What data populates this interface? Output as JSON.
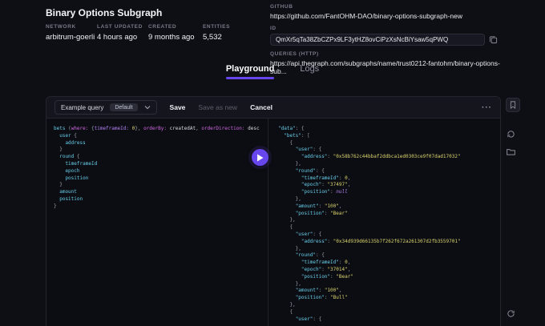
{
  "header": {
    "title": "Binary Options Subgraph",
    "meta": [
      {
        "label": "NETWORK",
        "value": "arbitrum-goerli"
      },
      {
        "label": "LAST UPDATED",
        "value": "4 hours ago"
      },
      {
        "label": "CREATED",
        "value": "9 months ago"
      },
      {
        "label": "ENTITIES",
        "value": "5,532"
      }
    ],
    "github_label": "GITHUB",
    "github_url": "https://github.com/FantOHM-DAO/binary-options-subgraph-new",
    "id_label": "ID",
    "id_value": "QmXr5qTa38ZbCZPx9LF3ytHZ8ovCiPzXsNcBiYsaw5qPWQ",
    "queries_label": "QUERIES (HTTP)",
    "queries_url": "https://api.thegraph.com/subgraphs/name/trust0212-fantohm/binary-options-sub..."
  },
  "tabs": [
    {
      "label": "Playground",
      "active": true
    },
    {
      "label": "Logs",
      "active": false
    }
  ],
  "toolbar": {
    "query_selector_label": "Example query",
    "query_selector_badge": "Default",
    "save_label": "Save",
    "save_as_new_label": "Save as new",
    "cancel_label": "Cancel",
    "more_label": "···"
  },
  "colors": {
    "accent": "#6747ed",
    "syn-field": "#67cdea",
    "syn-kw": "#cf68e1",
    "syn-attr": "#b381f5",
    "syn-num": "#d9d26e",
    "syn-key": "#67cdea",
    "syn-str": "#d9d26e",
    "syn-nul": "#b381f5",
    "syn-pun": "#9aa0ae",
    "syn-val": "#d6dae4"
  },
  "playground": {
    "query_lines": [
      [
        [
          "bets ",
          "field"
        ],
        [
          "(",
          "pun"
        ],
        [
          "where: ",
          "kw"
        ],
        [
          "{",
          "pun"
        ],
        [
          "timeframeId: ",
          "attr"
        ],
        [
          "0",
          "num"
        ],
        [
          "}",
          "pun"
        ],
        [
          ", ",
          "pun"
        ],
        [
          "orderBy: ",
          "kw"
        ],
        [
          "createdAt",
          "val"
        ],
        [
          ", ",
          "pun"
        ],
        [
          "orderDirection: ",
          "kw"
        ],
        [
          "desc",
          "val"
        ]
      ],
      [
        [
          "  user ",
          "field"
        ],
        [
          "{",
          "pun"
        ]
      ],
      [
        [
          "    address",
          "field"
        ]
      ],
      [
        [
          "  }",
          "pun"
        ]
      ],
      [
        [
          "  round ",
          "field"
        ],
        [
          "{",
          "pun"
        ]
      ],
      [
        [
          "    timeframeId",
          "field"
        ]
      ],
      [
        [
          "    epoch",
          "field"
        ]
      ],
      [
        [
          "    position",
          "field"
        ]
      ],
      [
        [
          "  }",
          "pun"
        ]
      ],
      [
        [
          "  amount",
          "field"
        ]
      ],
      [
        [
          "  position",
          "field"
        ]
      ],
      [
        [
          "}",
          "pun"
        ]
      ]
    ],
    "result_lines": [
      [
        [
          "\"data\"",
          "key"
        ],
        [
          ": {",
          "pun"
        ]
      ],
      [
        [
          "  ",
          "pun"
        ],
        [
          "\"bets\"",
          "key"
        ],
        [
          ": [",
          "pun"
        ]
      ],
      [
        [
          "    {",
          "pun"
        ]
      ],
      [
        [
          "      ",
          "pun"
        ],
        [
          "\"user\"",
          "key"
        ],
        [
          ": {",
          "pun"
        ]
      ],
      [
        [
          "        ",
          "pun"
        ],
        [
          "\"address\"",
          "key"
        ],
        [
          ": ",
          "pun"
        ],
        [
          "\"0x58b762c44bbaf2ddbca1ed0303ce9f07dad17032\"",
          "str"
        ]
      ],
      [
        [
          "      },",
          "pun"
        ]
      ],
      [
        [
          "      ",
          "pun"
        ],
        [
          "\"round\"",
          "key"
        ],
        [
          ": {",
          "pun"
        ]
      ],
      [
        [
          "        ",
          "pun"
        ],
        [
          "\"timeframeId\"",
          "key"
        ],
        [
          ": ",
          "pun"
        ],
        [
          "0",
          "num"
        ],
        [
          ",",
          "pun"
        ]
      ],
      [
        [
          "        ",
          "pun"
        ],
        [
          "\"epoch\"",
          "key"
        ],
        [
          ": ",
          "pun"
        ],
        [
          "\"37497\"",
          "str"
        ],
        [
          ",",
          "pun"
        ]
      ],
      [
        [
          "        ",
          "pun"
        ],
        [
          "\"position\"",
          "key"
        ],
        [
          ": ",
          "pun"
        ],
        [
          "null",
          "nul"
        ]
      ],
      [
        [
          "      },",
          "pun"
        ]
      ],
      [
        [
          "      ",
          "pun"
        ],
        [
          "\"amount\"",
          "key"
        ],
        [
          ": ",
          "pun"
        ],
        [
          "\"100\"",
          "str"
        ],
        [
          ",",
          "pun"
        ]
      ],
      [
        [
          "      ",
          "pun"
        ],
        [
          "\"position\"",
          "key"
        ],
        [
          ": ",
          "pun"
        ],
        [
          "\"Bear\"",
          "str"
        ]
      ],
      [
        [
          "    },",
          "pun"
        ]
      ],
      [
        [
          "    {",
          "pun"
        ]
      ],
      [
        [
          "      ",
          "pun"
        ],
        [
          "\"user\"",
          "key"
        ],
        [
          ": {",
          "pun"
        ]
      ],
      [
        [
          "        ",
          "pun"
        ],
        [
          "\"address\"",
          "key"
        ],
        [
          ": ",
          "pun"
        ],
        [
          "\"0x34d939d66135b7f262f672a261307d2fb3559701\"",
          "str"
        ]
      ],
      [
        [
          "      },",
          "pun"
        ]
      ],
      [
        [
          "      ",
          "pun"
        ],
        [
          "\"round\"",
          "key"
        ],
        [
          ": {",
          "pun"
        ]
      ],
      [
        [
          "        ",
          "pun"
        ],
        [
          "\"timeframeId\"",
          "key"
        ],
        [
          ": ",
          "pun"
        ],
        [
          "0",
          "num"
        ],
        [
          ",",
          "pun"
        ]
      ],
      [
        [
          "        ",
          "pun"
        ],
        [
          "\"epoch\"",
          "key"
        ],
        [
          ": ",
          "pun"
        ],
        [
          "\"37014\"",
          "str"
        ],
        [
          ",",
          "pun"
        ]
      ],
      [
        [
          "        ",
          "pun"
        ],
        [
          "\"position\"",
          "key"
        ],
        [
          ": ",
          "pun"
        ],
        [
          "\"Bear\"",
          "str"
        ]
      ],
      [
        [
          "      },",
          "pun"
        ]
      ],
      [
        [
          "      ",
          "pun"
        ],
        [
          "\"amount\"",
          "key"
        ],
        [
          ": ",
          "pun"
        ],
        [
          "\"100\"",
          "str"
        ],
        [
          ",",
          "pun"
        ]
      ],
      [
        [
          "      ",
          "pun"
        ],
        [
          "\"position\"",
          "key"
        ],
        [
          ": ",
          "pun"
        ],
        [
          "\"Bull\"",
          "str"
        ]
      ],
      [
        [
          "    },",
          "pun"
        ]
      ],
      [
        [
          "    {",
          "pun"
        ]
      ],
      [
        [
          "      ",
          "pun"
        ],
        [
          "\"user\"",
          "key"
        ],
        [
          ": {",
          "pun"
        ]
      ]
    ]
  }
}
